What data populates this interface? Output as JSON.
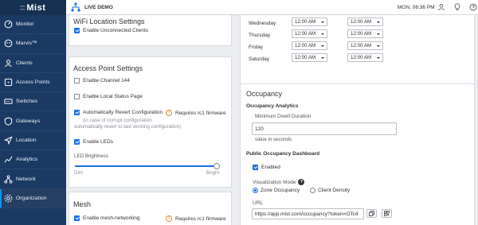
{
  "brand": {
    "name": "Mist"
  },
  "sidebar": {
    "items": [
      {
        "label": "Monitor",
        "icon": "monitor-icon"
      },
      {
        "label": "Marvis™",
        "icon": "marvis-icon"
      },
      {
        "label": "Clients",
        "icon": "clients-icon"
      },
      {
        "label": "Access Points",
        "icon": "access-points-icon"
      },
      {
        "label": "Switches",
        "icon": "switches-icon"
      },
      {
        "label": "Gateways",
        "icon": "gateways-icon"
      },
      {
        "label": "Location",
        "icon": "location-icon"
      },
      {
        "label": "Analytics",
        "icon": "analytics-icon"
      },
      {
        "label": "Network",
        "icon": "network-icon"
      },
      {
        "label": "Organization",
        "icon": "organization-icon",
        "active": true
      }
    ]
  },
  "header": {
    "live_label": "LIVE DEMO",
    "datetime": "MON, 06:36 PM"
  },
  "wifi_location": {
    "title": "WiFi Location Settings",
    "enable_unconnected_clients": {
      "label": "Enable Unconnected Clients",
      "checked": true
    }
  },
  "ap_settings": {
    "title": "Access Point Settings",
    "enable_channel_144": {
      "label": "Enable Channel 144",
      "checked": false
    },
    "enable_local_status": {
      "label": "Enable Local Status Page",
      "checked": false
    },
    "auto_revert": {
      "label": "Automatically Revert Configuration",
      "checked": true,
      "note_line1": "(in case of corrupt configuration",
      "note_line2": "automatically revert to last working configuration)",
      "requires": "Requires rc1 firmware"
    },
    "enable_leds": {
      "label": "Enable LEDs",
      "checked": true
    },
    "led_brightness": {
      "label": "LED Brightness",
      "min_label": "Dim",
      "max_label": "Bright",
      "value": 1.0
    }
  },
  "mesh": {
    "title": "Mesh",
    "enable_mesh": {
      "label": "Enable mesh-networking",
      "checked": true,
      "requires": "Requires rc1 firmware"
    }
  },
  "schedule": {
    "rows": [
      {
        "day": "Wednesday",
        "start": "12:00 AM",
        "end": "12:00 AM"
      },
      {
        "day": "Thursday",
        "start": "12:00 AM",
        "end": "12:00 AM"
      },
      {
        "day": "Friday",
        "start": "12:00 AM",
        "end": "12:00 AM"
      },
      {
        "day": "Saturday",
        "start": "12:00 AM",
        "end": "12:00 AM"
      }
    ]
  },
  "occupancy": {
    "title": "Occupancy",
    "analytics_heading": "Occupancy Analytics",
    "dwell_label": "Minimum Dwell Duration",
    "dwell_value": "120",
    "dwell_unit": "value in seconds",
    "public_heading": "Public Occupancy Dashboard",
    "enabled": {
      "label": "Enabled",
      "checked": true
    },
    "viz_label": "Visualization Mode",
    "viz_options": [
      {
        "label": "Zone Occupancy",
        "selected": true
      },
      {
        "label": "Client Density",
        "selected": false
      }
    ],
    "url_label": "URL",
    "url_value": "https://app.mist.com/occupancy?token=OTc4"
  },
  "colors": {
    "sidebar": "#1b3a63",
    "accent": "#1a73e8",
    "warning": "#e8862d"
  }
}
